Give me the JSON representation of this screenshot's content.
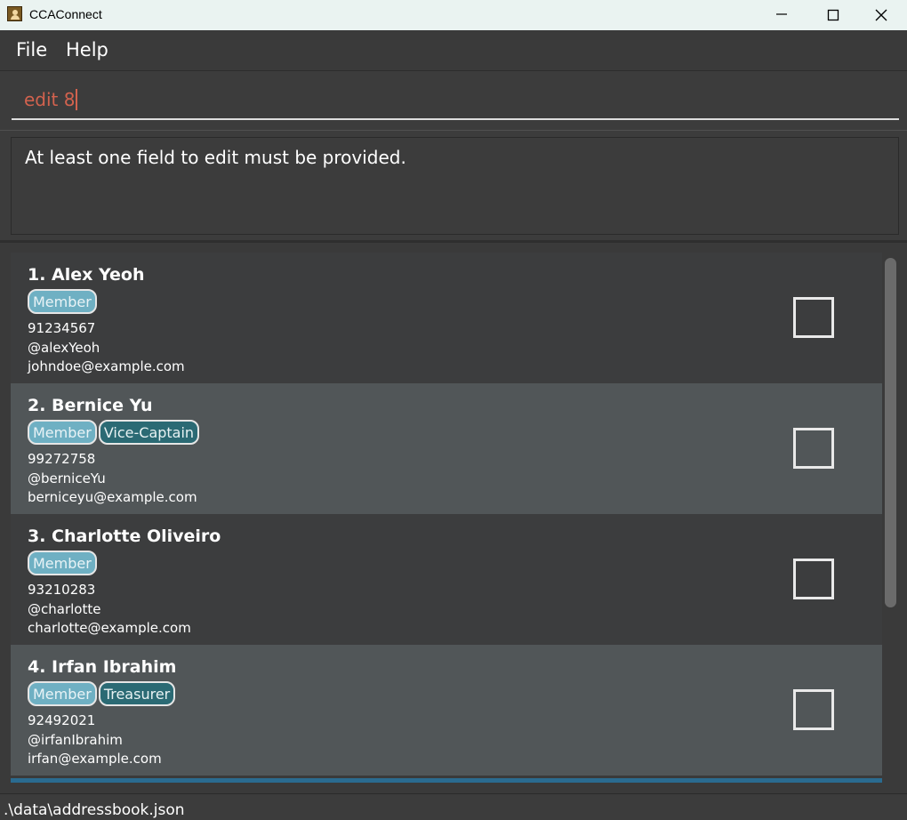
{
  "window": {
    "title": "CCAConnect"
  },
  "menu": {
    "file": "File",
    "help": "Help"
  },
  "command": {
    "value": "edit 8"
  },
  "result": {
    "message": "At least one field to edit must be provided."
  },
  "contacts": [
    {
      "index_name": "1. Alex Yeoh",
      "tags": [
        "Member"
      ],
      "phone": "91234567",
      "handle": "@alexYeoh",
      "email": "johndoe@example.com",
      "checked": false
    },
    {
      "index_name": "2. Bernice Yu",
      "tags": [
        "Member",
        "Vice-Captain"
      ],
      "phone": "99272758",
      "handle": "@berniceYu",
      "email": "berniceyu@example.com",
      "checked": false
    },
    {
      "index_name": "3. Charlotte Oliveiro",
      "tags": [
        "Member"
      ],
      "phone": "93210283",
      "handle": "@charlotte",
      "email": "charlotte@example.com",
      "checked": false
    },
    {
      "index_name": "4. Irfan Ibrahim",
      "tags": [
        "Member",
        "Treasurer"
      ],
      "phone": "92492021",
      "handle": "@irfanIbrahim",
      "email": "irfan@example.com",
      "checked": false
    }
  ],
  "status": {
    "file_path": ".\\data\\addressbook.json"
  },
  "colors": {
    "member_tag": "#6fb0c3",
    "role_tag": "#2b6a74",
    "command_text": "#d2624e",
    "card_odd": "#3c3d3e",
    "card_even": "#515658"
  }
}
